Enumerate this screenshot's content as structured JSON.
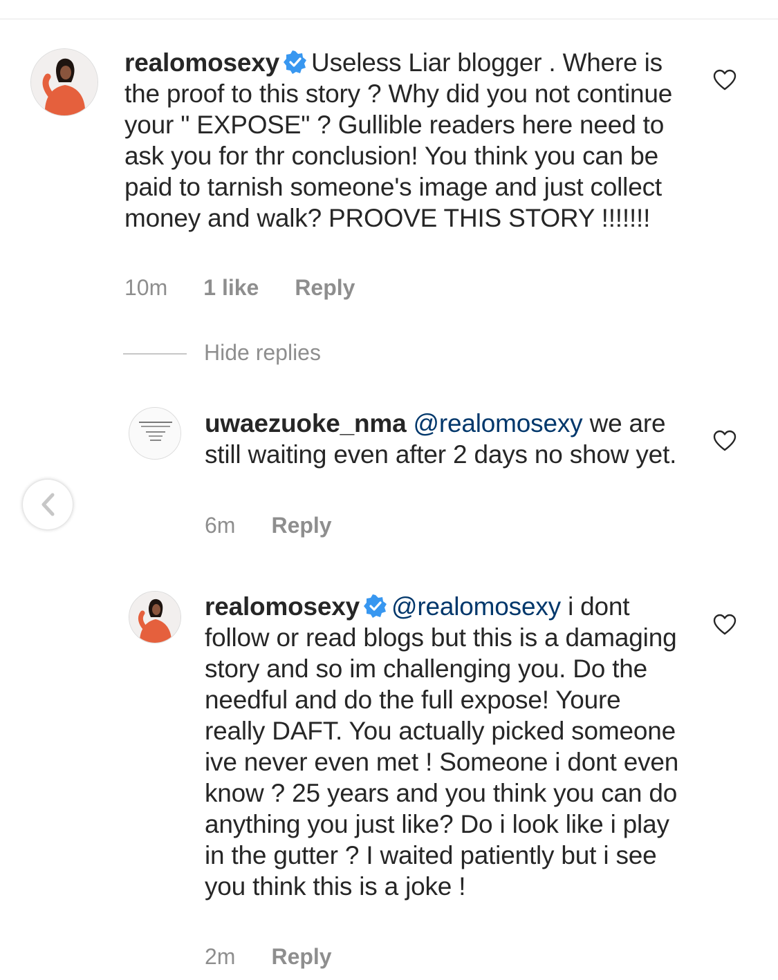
{
  "comments": [
    {
      "username": "realomosexy",
      "verified": true,
      "text": "Useless Liar blogger . Where is the proof to this story ? Why did you not continue your \" EXPOSE\" ? Gullible readers here need to ask you for thr conclusion! You think you can be paid to tarnish someone's image and just collect money and walk? PROOVE THIS STORY !!!!!!!",
      "time": "10m",
      "likes": "1 like",
      "reply_label": "Reply"
    }
  ],
  "hide_replies_label": "Hide replies",
  "replies": [
    {
      "username": "uwaezuoke_nma",
      "verified": false,
      "mention": "@realomosexy",
      "text": "we are still waiting even after 2 days no show yet.",
      "time": "6m",
      "reply_label": "Reply"
    },
    {
      "username": "realomosexy",
      "verified": true,
      "mention": "@realomosexy",
      "text": "i dont follow or read blogs but this is a damaging story and so im challenging you. Do the needful and do the full expose! Youre really DAFT. You actually picked someone ive never even met ! Someone i dont even know ? 25 years and you think you can do anything you just like? Do i look like i play in the gutter ? I waited patiently but i see you think this is a joke !",
      "time": "2m",
      "reply_label": "Reply"
    }
  ],
  "icons": {
    "verified": "verified-badge-icon",
    "like": "heart-icon",
    "back": "chevron-left-icon"
  },
  "colors": {
    "verified_badge": "#3897f0",
    "mention": "#00376b",
    "meta_text": "#8e8e8e",
    "avatar_outfit": "#e5603d"
  }
}
